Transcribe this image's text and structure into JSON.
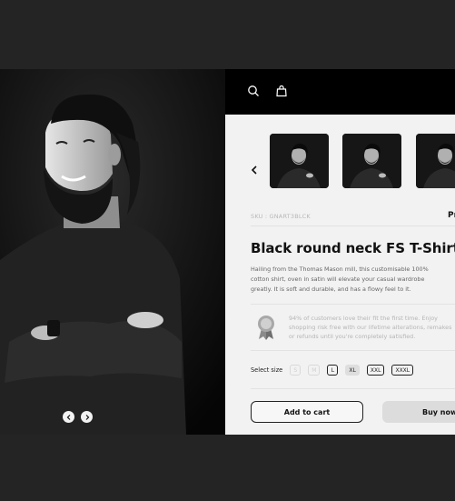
{
  "product": {
    "sku": "SKU : GNART3BLCK",
    "price_partial": "Pr",
    "title": "Black round neck FS T-Shirt",
    "description": "Hailing from the Thomas Mason mill, this customisable 100% cotton shirt, oven in satin will elevate your casual wardrobe greatly. It is soft and durable, and has a flowy feel to it."
  },
  "promise": {
    "icon": "award-ribbon-icon",
    "text": "94% of customers love their fit the first time. Enjoy shopping risk free with our lifetime alterations, remakes or refunds until you're completely satisfied."
  },
  "sizes": {
    "label": "Select size",
    "options": [
      {
        "label": "S",
        "state": "unavailable"
      },
      {
        "label": "M",
        "state": "unavailable"
      },
      {
        "label": "L",
        "state": "available"
      },
      {
        "label": "XL",
        "state": "selected"
      },
      {
        "label": "XXL",
        "state": "available"
      },
      {
        "label": "XXXL",
        "state": "available"
      }
    ]
  },
  "actions": {
    "add_to_cart": "Add to cart",
    "buy_now": "Buy now"
  },
  "header": {
    "icons": [
      "search-icon",
      "shopping-bag-icon"
    ]
  },
  "colors": {
    "header_bg": "#000000",
    "panel_bg": "#f2f2f2",
    "page_bg": "#242424"
  }
}
